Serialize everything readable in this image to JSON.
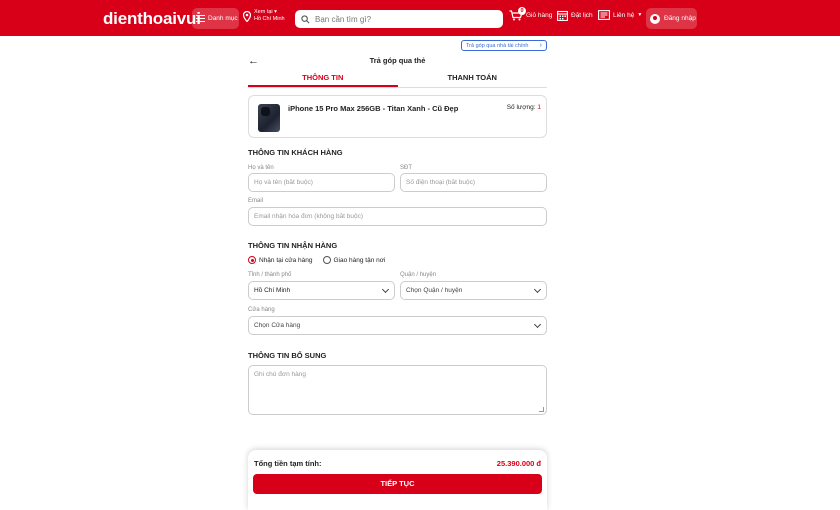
{
  "header": {
    "logo": "dienthoaivui",
    "menu_label": "Danh mục",
    "location_line1": "Xem tại ▾",
    "location_line2": "Hồ Chí Minh",
    "search_placeholder": "Bạn cần tìm gì?",
    "cart_label": "Giỏ hàng",
    "cart_count": "0",
    "booking_label": "Đặt lịch",
    "contact_label": "Liên hệ",
    "login_label": "Đăng nhập"
  },
  "page": {
    "installment_link": "Trả góp qua nhà tài chính",
    "title": "Trả góp qua thẻ",
    "tabs": [
      {
        "label": "THÔNG TIN",
        "active": true
      },
      {
        "label": "THANH TOÁN",
        "active": false
      }
    ]
  },
  "product": {
    "name": "iPhone 15 Pro Max 256GB - Titan Xanh - Cũ Đẹp",
    "qty_label": "Số lượng:",
    "qty_value": "1"
  },
  "customer": {
    "section_title": "THÔNG TIN KHÁCH HÀNG",
    "name_label": "Họ và tên",
    "name_placeholder": "Họ và tên (bắt buộc)",
    "phone_label": "SĐT",
    "phone_placeholder": "Số điện thoại (bắt buộc)",
    "email_label": "Email",
    "email_placeholder": "Email nhận hóa đơn (không bắt buộc)"
  },
  "delivery": {
    "section_title": "THÔNG TIN NHẬN HÀNG",
    "option_store": "Nhận tại cửa hàng",
    "option_home": "Giao hàng tận nơi",
    "province_label": "Tỉnh / thành phố",
    "province_value": "Hồ Chí Minh",
    "district_label": "Quận / huyện",
    "district_value": "Chọn Quận / huyện",
    "store_label": "Cửa hàng",
    "store_value": "Chọn Cửa hàng"
  },
  "extra": {
    "section_title": "THÔNG TIN BỔ SUNG",
    "notes_placeholder": "Ghi chú đơn hàng"
  },
  "summary": {
    "total_label": "Tổng tiền tạm tính:",
    "total_value": "25.390.000 đ",
    "continue_label": "TIẾP TỤC"
  },
  "colors": {
    "brand_red": "#d70018",
    "link_blue": "#3b6bd6"
  }
}
